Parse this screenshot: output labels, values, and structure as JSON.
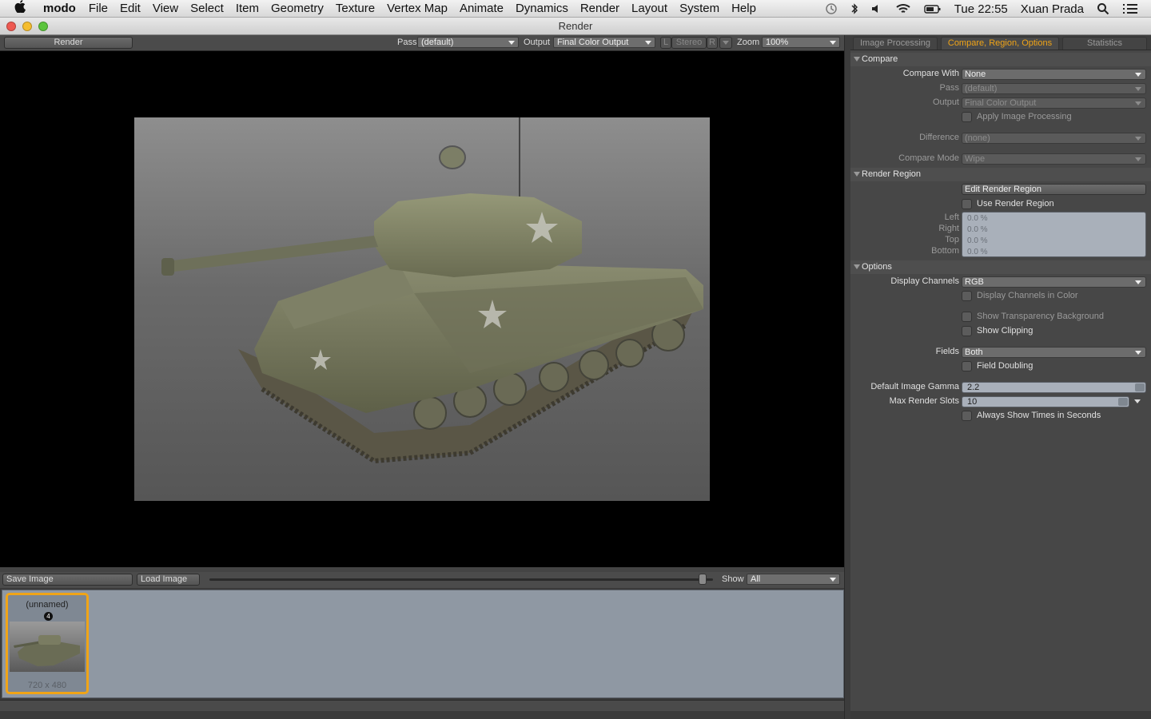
{
  "menubar": {
    "app": "modo",
    "items": [
      "File",
      "Edit",
      "View",
      "Select",
      "Item",
      "Geometry",
      "Texture",
      "Vertex Map",
      "Animate",
      "Dynamics",
      "Render",
      "Layout",
      "System",
      "Help"
    ],
    "clock": "Tue 22:55",
    "user": "Xuan Prada"
  },
  "window": {
    "title": "Render"
  },
  "render_toolbar": {
    "render_button": "Render",
    "pass_label": "Pass",
    "pass_value": "(default)",
    "output_label": "Output",
    "output_value": "Final Color Output",
    "l_label": "L",
    "stereo_label": "Stereo",
    "r_label": "R",
    "zoom_label": "Zoom",
    "zoom_value": "100%"
  },
  "bottom_toolbar": {
    "save_image": "Save Image",
    "load_image": "Load Image",
    "show_label": "Show",
    "show_value": "All"
  },
  "thumbnail": {
    "name": "(unnamed)",
    "badge": "4",
    "dims": "720 x 480"
  },
  "panel": {
    "tabs": [
      "Image Processing",
      "Compare, Region, Options",
      "Statistics"
    ],
    "compare": {
      "header": "Compare",
      "compare_with_label": "Compare With",
      "compare_with_value": "None",
      "pass_label": "Pass",
      "pass_value": "(default)",
      "output_label": "Output",
      "output_value": "Final Color Output",
      "apply_image_processing": "Apply Image Processing",
      "difference_label": "Difference",
      "difference_value": "(none)",
      "compare_mode_label": "Compare Mode",
      "compare_mode_value": "Wipe"
    },
    "render_region": {
      "header": "Render Region",
      "edit_button": "Edit Render Region",
      "use_render_region": "Use Render Region",
      "left_label": "Left",
      "right_label": "Right",
      "top_label": "Top",
      "bottom_label": "Bottom",
      "left_value": "0.0 %",
      "right_value": "0.0 %",
      "top_value": "0.0 %",
      "bottom_value": "0.0 %"
    },
    "options": {
      "header": "Options",
      "display_channels_label": "Display Channels",
      "display_channels_value": "RGB",
      "display_channels_in_color": "Display Channels in Color",
      "show_transparency_background": "Show Transparency Background",
      "show_clipping": "Show Clipping",
      "fields_label": "Fields",
      "fields_value": "Both",
      "field_doubling": "Field Doubling",
      "gamma_label": "Default Image Gamma",
      "gamma_value": "2.2",
      "max_slots_label": "Max Render Slots",
      "max_slots_value": "10",
      "always_show_times": "Always Show Times in Seconds"
    }
  },
  "colors": {
    "accent": "#f0a417",
    "viewport_bg": "#000000",
    "panel_bg": "#474747"
  }
}
